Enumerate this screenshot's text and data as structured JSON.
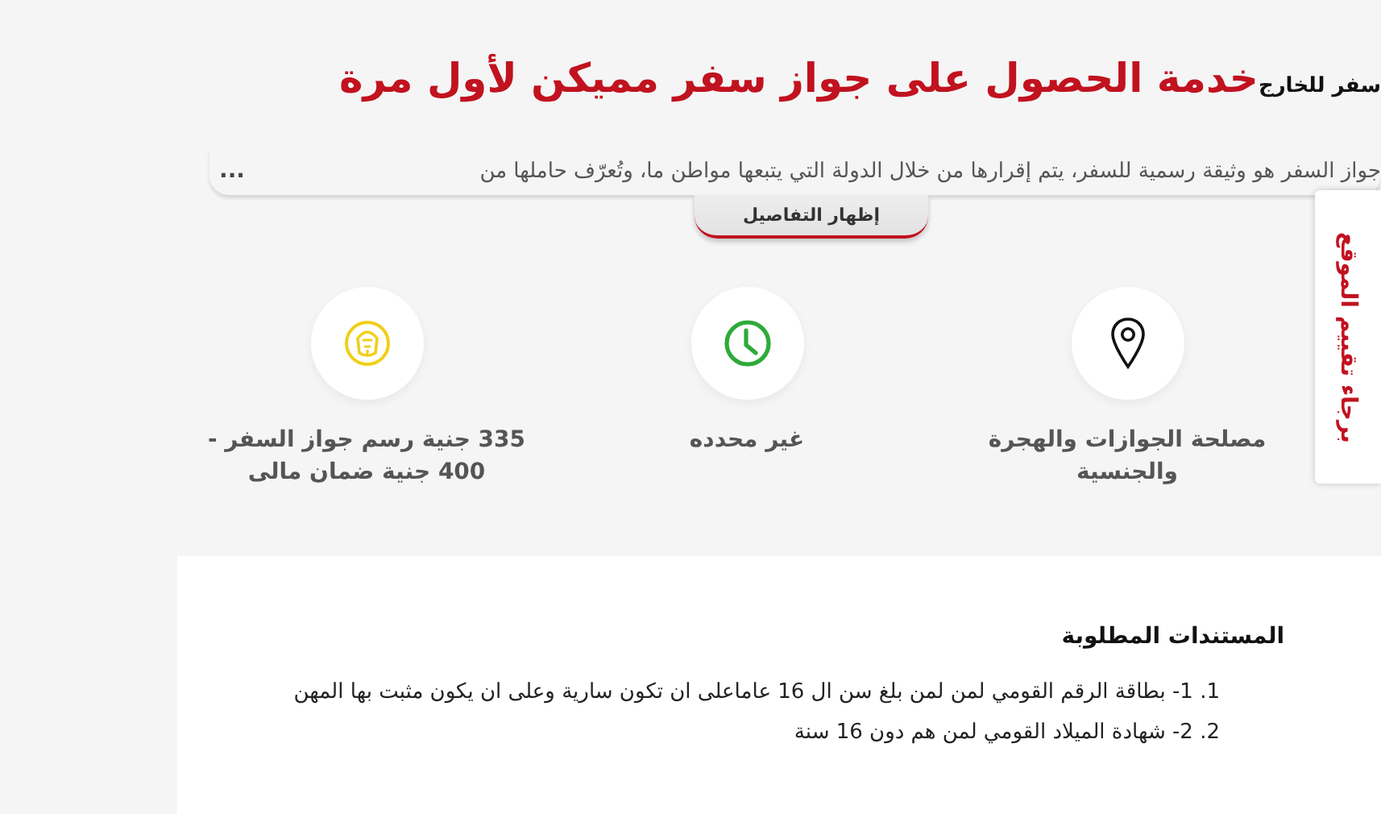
{
  "breadcrumb": "سفر للخارج",
  "title": "خدمة الحصول على جواز سفر مميكن لأول مرة",
  "description": {
    "text": "جواز السفر هو وثيقة رسمية للسفر، يتم إقرارها من خلال الدولة التي يتبعها مواطن ما، وتُعرّف حاملها من",
    "more": "..."
  },
  "details_button": "إظهار التفاصيل",
  "feedback_tab": "برجاء تقييم الموقع",
  "info": [
    {
      "kind": "location",
      "text": "مصلحة الجوازات والهجرة والجنسية"
    },
    {
      "kind": "time",
      "text": "غير محدده"
    },
    {
      "kind": "fee",
      "text": "335 جنية رسم جواز السفر - 400 جنية ضمان مالى"
    }
  ],
  "documents": {
    "heading": "المستندات المطلوبة",
    "items": [
      "1. 1- بطاقة الرقم القومي لمن لمن بلغ سن ال 16 عاماعلى ان تكون سارية وعلى ان يكون مثبت بها المهن",
      "2. 2- شهادة الميلاد القومي لمن هم دون 16 سنة"
    ]
  }
}
